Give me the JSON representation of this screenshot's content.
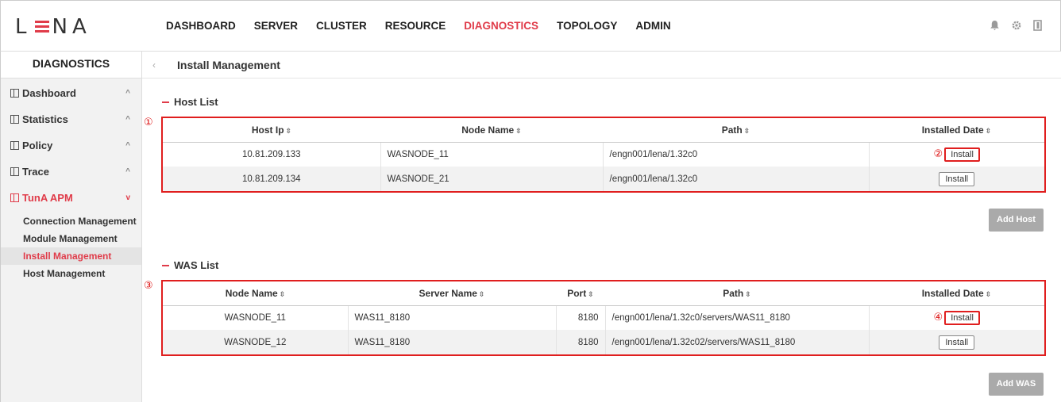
{
  "app": {
    "logo_text_left": "L",
    "logo_text_right": "NA"
  },
  "nav": {
    "items": [
      {
        "label": "DASHBOARD",
        "active": false
      },
      {
        "label": "SERVER",
        "active": false
      },
      {
        "label": "CLUSTER",
        "active": false
      },
      {
        "label": "RESOURCE",
        "active": false
      },
      {
        "label": "DIAGNOSTICS",
        "active": true
      },
      {
        "label": "TOPOLOGY",
        "active": false
      },
      {
        "label": "ADMIN",
        "active": false
      }
    ],
    "icons": [
      "bell-icon",
      "gear-icon",
      "logout-icon"
    ]
  },
  "sidebar": {
    "title": "DIAGNOSTICS",
    "groups": [
      {
        "label": "Dashboard",
        "chevron": "^"
      },
      {
        "label": "Statistics",
        "chevron": "^"
      },
      {
        "label": "Policy",
        "chevron": "^"
      },
      {
        "label": "Trace",
        "chevron": "^"
      },
      {
        "label": "TunA APM",
        "chevron": "v"
      }
    ],
    "sub_items": [
      {
        "label": "Connection Management"
      },
      {
        "label": "Module Management"
      },
      {
        "label": "Install Management"
      },
      {
        "label": "Host Management"
      }
    ]
  },
  "main": {
    "title": "Install Management",
    "host_section": {
      "title": "Host List",
      "marker": "①",
      "columns": [
        "Host Ip",
        "Node Name",
        "Path",
        "Installed Date"
      ],
      "rows": [
        {
          "host_ip": "10.81.209.133",
          "node_name": "WASNODE_11",
          "path": "/engn001/lena/1.32c0",
          "action": "Install",
          "marker": "②"
        },
        {
          "host_ip": "10.81.209.134",
          "node_name": "WASNODE_21",
          "path": "/engn001/lena/1.32c0",
          "action": "Install",
          "marker": ""
        }
      ],
      "add_button": "Add Host"
    },
    "was_section": {
      "title": "WAS List",
      "marker": "③",
      "columns": [
        "Node Name",
        "Server Name",
        "Port",
        "Path",
        "Installed Date"
      ],
      "rows": [
        {
          "node_name": "WASNODE_11",
          "server_name": "WAS11_8180",
          "port": "8180",
          "path": "/engn001/lena/1.32c0/servers/WAS11_8180",
          "action": "Install",
          "marker": "④"
        },
        {
          "node_name": "WASNODE_12",
          "server_name": "WAS11_8180",
          "port": "8180",
          "path": "/engn001/lena/1.32c02/servers/WAS11_8180",
          "action": "Install",
          "marker": ""
        }
      ],
      "add_button": "Add WAS"
    }
  },
  "colors": {
    "accent": "#e03c4a",
    "highlight_border": "#e01e1e",
    "button_gray": "#aaaaaa"
  }
}
